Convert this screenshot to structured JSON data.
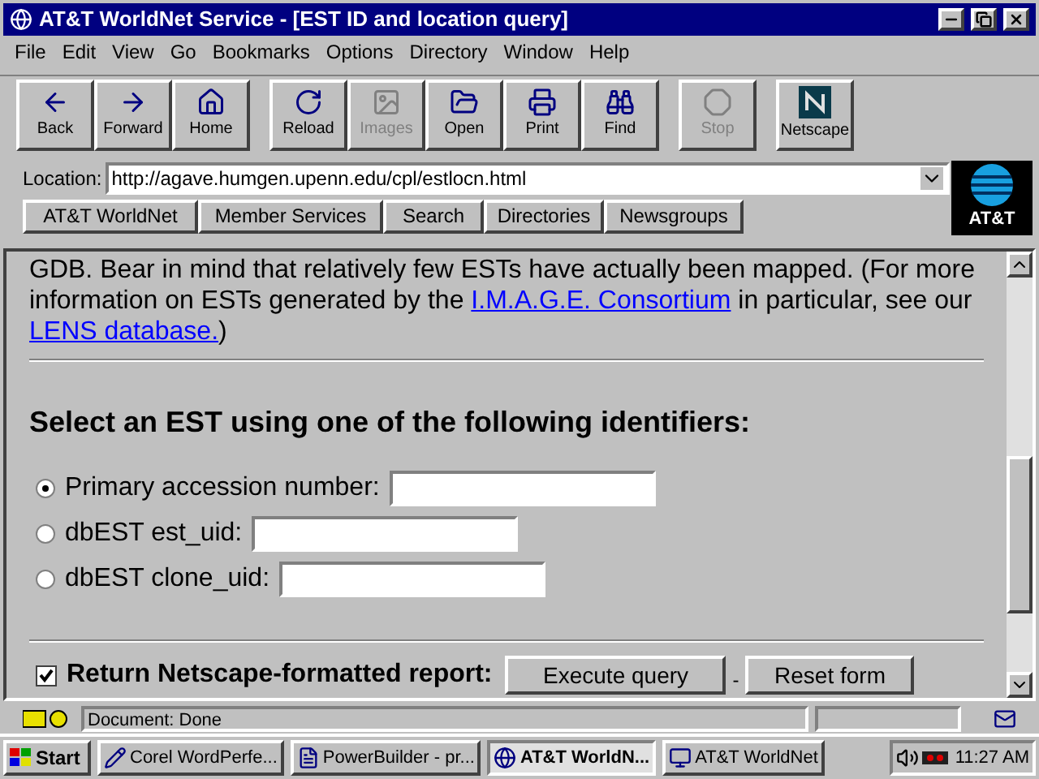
{
  "window": {
    "title": "AT&T WorldNet Service - [EST ID and location query]"
  },
  "menu": [
    "File",
    "Edit",
    "View",
    "Go",
    "Bookmarks",
    "Options",
    "Directory",
    "Window",
    "Help"
  ],
  "toolbar": [
    [
      {
        "label": "Back",
        "disabled": false
      },
      {
        "label": "Forward",
        "disabled": false
      },
      {
        "label": "Home",
        "disabled": false
      }
    ],
    [
      {
        "label": "Reload",
        "disabled": false
      },
      {
        "label": "Images",
        "disabled": true
      },
      {
        "label": "Open",
        "disabled": false
      },
      {
        "label": "Print",
        "disabled": false
      },
      {
        "label": "Find",
        "disabled": false
      }
    ],
    [
      {
        "label": "Stop",
        "disabled": true
      }
    ],
    [
      {
        "label": "Netscape",
        "disabled": false
      }
    ]
  ],
  "location": {
    "label": "Location:",
    "value": "http://agave.humgen.upenn.edu/cpl/estlocn.html"
  },
  "logo": {
    "label": "AT&T"
  },
  "directory_buttons": [
    "AT&T WorldNet",
    "Member Services",
    "Search",
    "Directories",
    "Newsgroups"
  ],
  "content": {
    "paragraph": [
      {
        "text": "GDB. Bear in mind that relatively few ESTs have actually been mapped. (For more information on ESTs generated by the ",
        "link": false
      },
      {
        "text": "I.M.A.G.E. Consortium",
        "link": true
      },
      {
        "text": " in particular, see our ",
        "link": false
      },
      {
        "text": "LENS database.",
        "link": true
      },
      {
        "text": ")",
        "link": false
      }
    ],
    "heading": "Select an EST using one of the following identifiers:",
    "options": [
      {
        "label": "Primary accession number:",
        "selected": true
      },
      {
        "label": "dbEST est_uid:",
        "selected": false
      },
      {
        "label": "dbEST clone_uid:",
        "selected": false
      }
    ],
    "report": {
      "label": "Return Netscape-formatted report:",
      "checked": true
    },
    "buttons": [
      "Execute query",
      "Reset form"
    ],
    "separator": "-"
  },
  "status_bar": {
    "text": "Document: Done"
  },
  "taskbar": {
    "start": "Start",
    "items": [
      {
        "label": "Corel WordPerfe...",
        "selected": false
      },
      {
        "label": "PowerBuilder - pr...",
        "selected": false
      },
      {
        "label": "AT&T WorldN...",
        "selected": true
      },
      {
        "label": "AT&T WorldNet",
        "selected": false
      }
    ],
    "time": "11:27 AM"
  }
}
